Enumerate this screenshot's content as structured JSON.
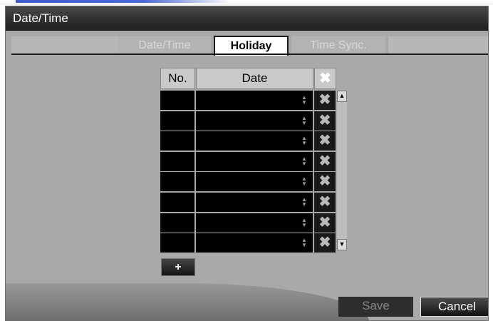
{
  "window": {
    "title": "Date/Time"
  },
  "tabs": [
    {
      "label": "Date/Time",
      "state": "inactive"
    },
    {
      "label": "Holiday",
      "state": "active"
    },
    {
      "label": "Time Sync.",
      "state": "inactive"
    }
  ],
  "holiday_table": {
    "headers": {
      "no": "No.",
      "date": "Date",
      "delete": "✖"
    },
    "rows": [
      {
        "no": "",
        "date": ""
      },
      {
        "no": "",
        "date": ""
      },
      {
        "no": "",
        "date": ""
      },
      {
        "no": "",
        "date": ""
      },
      {
        "no": "",
        "date": ""
      },
      {
        "no": "",
        "date": ""
      },
      {
        "no": "",
        "date": ""
      },
      {
        "no": "",
        "date": ""
      }
    ],
    "delete_icon": "✖",
    "spin_up": "▲",
    "spin_down": "▼",
    "scroll_up": "▲",
    "scroll_down": "▼"
  },
  "add_button": {
    "label": "+"
  },
  "footer": {
    "save_label": "Save",
    "cancel_label": "Cancel"
  }
}
